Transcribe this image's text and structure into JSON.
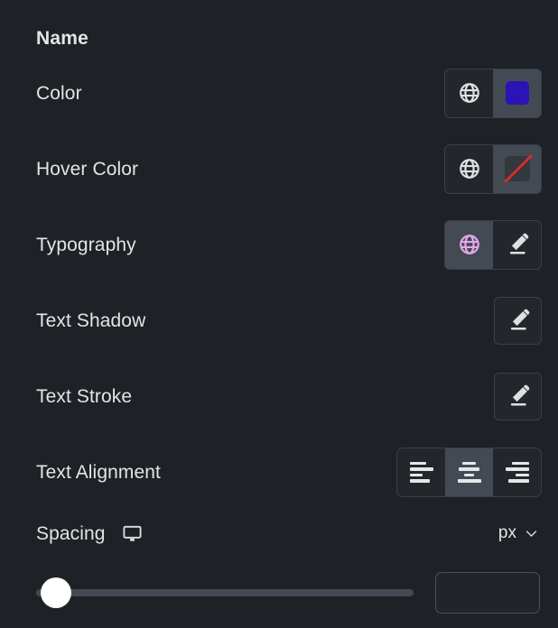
{
  "panel": {
    "background": "#1e2126",
    "title": "Name"
  },
  "rows": [
    {
      "id": "name",
      "label": "Name"
    },
    {
      "id": "color",
      "label": "Color",
      "globe_icon": "globe-icon",
      "swatch_color": "#2b13b5"
    },
    {
      "id": "hover-color",
      "label": "Hover Color",
      "globe_icon": "globe-icon",
      "swatch_color": "none",
      "slash_color": "#d52b2b"
    },
    {
      "id": "typography",
      "label": "Typography",
      "globe_icon": "globe-icon",
      "globe_color": "#e4a8e8",
      "edit_icon": "pencil-icon"
    },
    {
      "id": "text-shadow",
      "label": "Text Shadow",
      "edit_icon": "pencil-icon"
    },
    {
      "id": "text-stroke",
      "label": "Text Stroke",
      "edit_icon": "pencil-icon"
    },
    {
      "id": "text-alignment",
      "label": "Text Alignment",
      "options": [
        "left",
        "center",
        "right"
      ],
      "selected": "center"
    },
    {
      "id": "spacing",
      "label": "Spacing",
      "device_icon": "desktop-icon",
      "unit": "px",
      "chevron": "chevron-down-icon"
    }
  ],
  "slider": {
    "value": "",
    "placeholder": "",
    "position_percent": 0,
    "thumb_color": "#ffffff",
    "track_color": "#434a54"
  }
}
